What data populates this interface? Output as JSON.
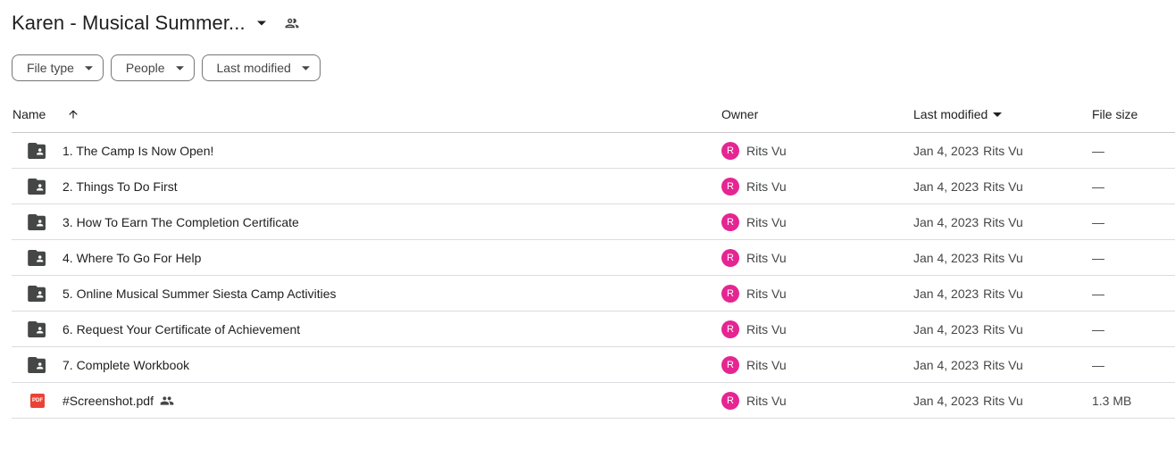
{
  "header": {
    "title": "Karen - Musical Summer...",
    "caret_icon": "arrow-drop-down-icon",
    "shared_icon": "people-icon"
  },
  "filters": [
    {
      "label": "File type",
      "icon": "arrow-drop-down-icon"
    },
    {
      "label": "People",
      "icon": "arrow-drop-down-icon"
    },
    {
      "label": "Last modified",
      "icon": "arrow-drop-down-icon"
    }
  ],
  "columns": {
    "name": "Name",
    "owner": "Owner",
    "last_modified": "Last modified",
    "file_size": "File size",
    "sort_icon": "arrow-up-icon"
  },
  "rows": [
    {
      "type": "shared-folder",
      "name": "1. The Camp Is Now Open!",
      "owner_initial": "R",
      "owner": "Rits Vu",
      "modified_date": "Jan 4, 2023",
      "modified_by": "Rits Vu",
      "size": "—"
    },
    {
      "type": "shared-folder",
      "name": "2. Things To Do First",
      "owner_initial": "R",
      "owner": "Rits Vu",
      "modified_date": "Jan 4, 2023",
      "modified_by": "Rits Vu",
      "size": "—"
    },
    {
      "type": "shared-folder",
      "name": "3. How To Earn The Completion Certificate",
      "owner_initial": "R",
      "owner": "Rits Vu",
      "modified_date": "Jan 4, 2023",
      "modified_by": "Rits Vu",
      "size": "—"
    },
    {
      "type": "shared-folder",
      "name": "4. Where To Go For Help",
      "owner_initial": "R",
      "owner": "Rits Vu",
      "modified_date": "Jan 4, 2023",
      "modified_by": "Rits Vu",
      "size": "—"
    },
    {
      "type": "shared-folder",
      "name": "5. Online Musical Summer Siesta Camp Activities",
      "owner_initial": "R",
      "owner": "Rits Vu",
      "modified_date": "Jan 4, 2023",
      "modified_by": "Rits Vu",
      "size": "—"
    },
    {
      "type": "shared-folder",
      "name": "6. Request Your Certificate of Achievement",
      "owner_initial": "R",
      "owner": "Rits Vu",
      "modified_date": "Jan 4, 2023",
      "modified_by": "Rits Vu",
      "size": "—"
    },
    {
      "type": "shared-folder",
      "name": "7. Complete Workbook",
      "owner_initial": "R",
      "owner": "Rits Vu",
      "modified_date": "Jan 4, 2023",
      "modified_by": "Rits Vu",
      "size": "—"
    },
    {
      "type": "pdf",
      "badge": "PDF",
      "name": "#Screenshot.pdf",
      "shared": true,
      "owner_initial": "R",
      "owner": "Rits Vu",
      "modified_date": "Jan 4, 2023",
      "modified_by": "Rits Vu",
      "size": "1.3 MB"
    }
  ],
  "colors": {
    "avatar": "#e52592",
    "pdf": "#ea4335",
    "folder": "#444746"
  }
}
